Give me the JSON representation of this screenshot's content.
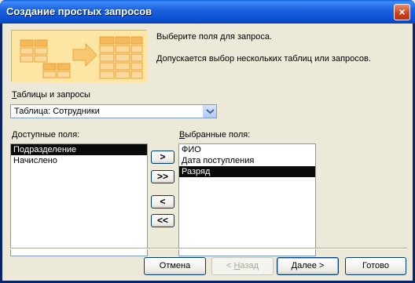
{
  "window": {
    "title": "Создание простых запросов",
    "close_glyph": "×",
    "colors": {
      "titlebar": "#1d64e0",
      "client": "#ece9d8",
      "graphic_bg": "#fde6a3",
      "selection": "#0a0a0a"
    }
  },
  "instructions": {
    "line1": "Выберите поля для запроса.",
    "line2": "Допускается выбор нескольких таблиц или запросов."
  },
  "tables": {
    "label_prefix": "",
    "label_mnemonic": "Т",
    "label_rest": "аблицы и запросы",
    "selected": "Таблица: Сотрудники"
  },
  "available": {
    "label_mnemonic": "Д",
    "label_rest": "оступные поля:",
    "items": [
      {
        "label": "Подразделение",
        "selected": true
      },
      {
        "label": "Начислено",
        "selected": false
      }
    ]
  },
  "selected_fields": {
    "label_mnemonic": "В",
    "label_rest": "ыбранные поля:",
    "items": [
      {
        "label": "ФИО",
        "selected": false
      },
      {
        "label": "Дата поступления",
        "selected": false
      },
      {
        "label": "Разряд",
        "selected": true
      }
    ]
  },
  "move_buttons": {
    "add_one": ">",
    "add_all": ">>",
    "remove_one": "<",
    "remove_all": "<<"
  },
  "footer": {
    "cancel": "Отмена",
    "back_prefix": "< ",
    "back_mnemonic": "Н",
    "back_rest": "азад",
    "next_mnemonic": "Д",
    "next_rest": "алее >",
    "finish": "Готово"
  }
}
